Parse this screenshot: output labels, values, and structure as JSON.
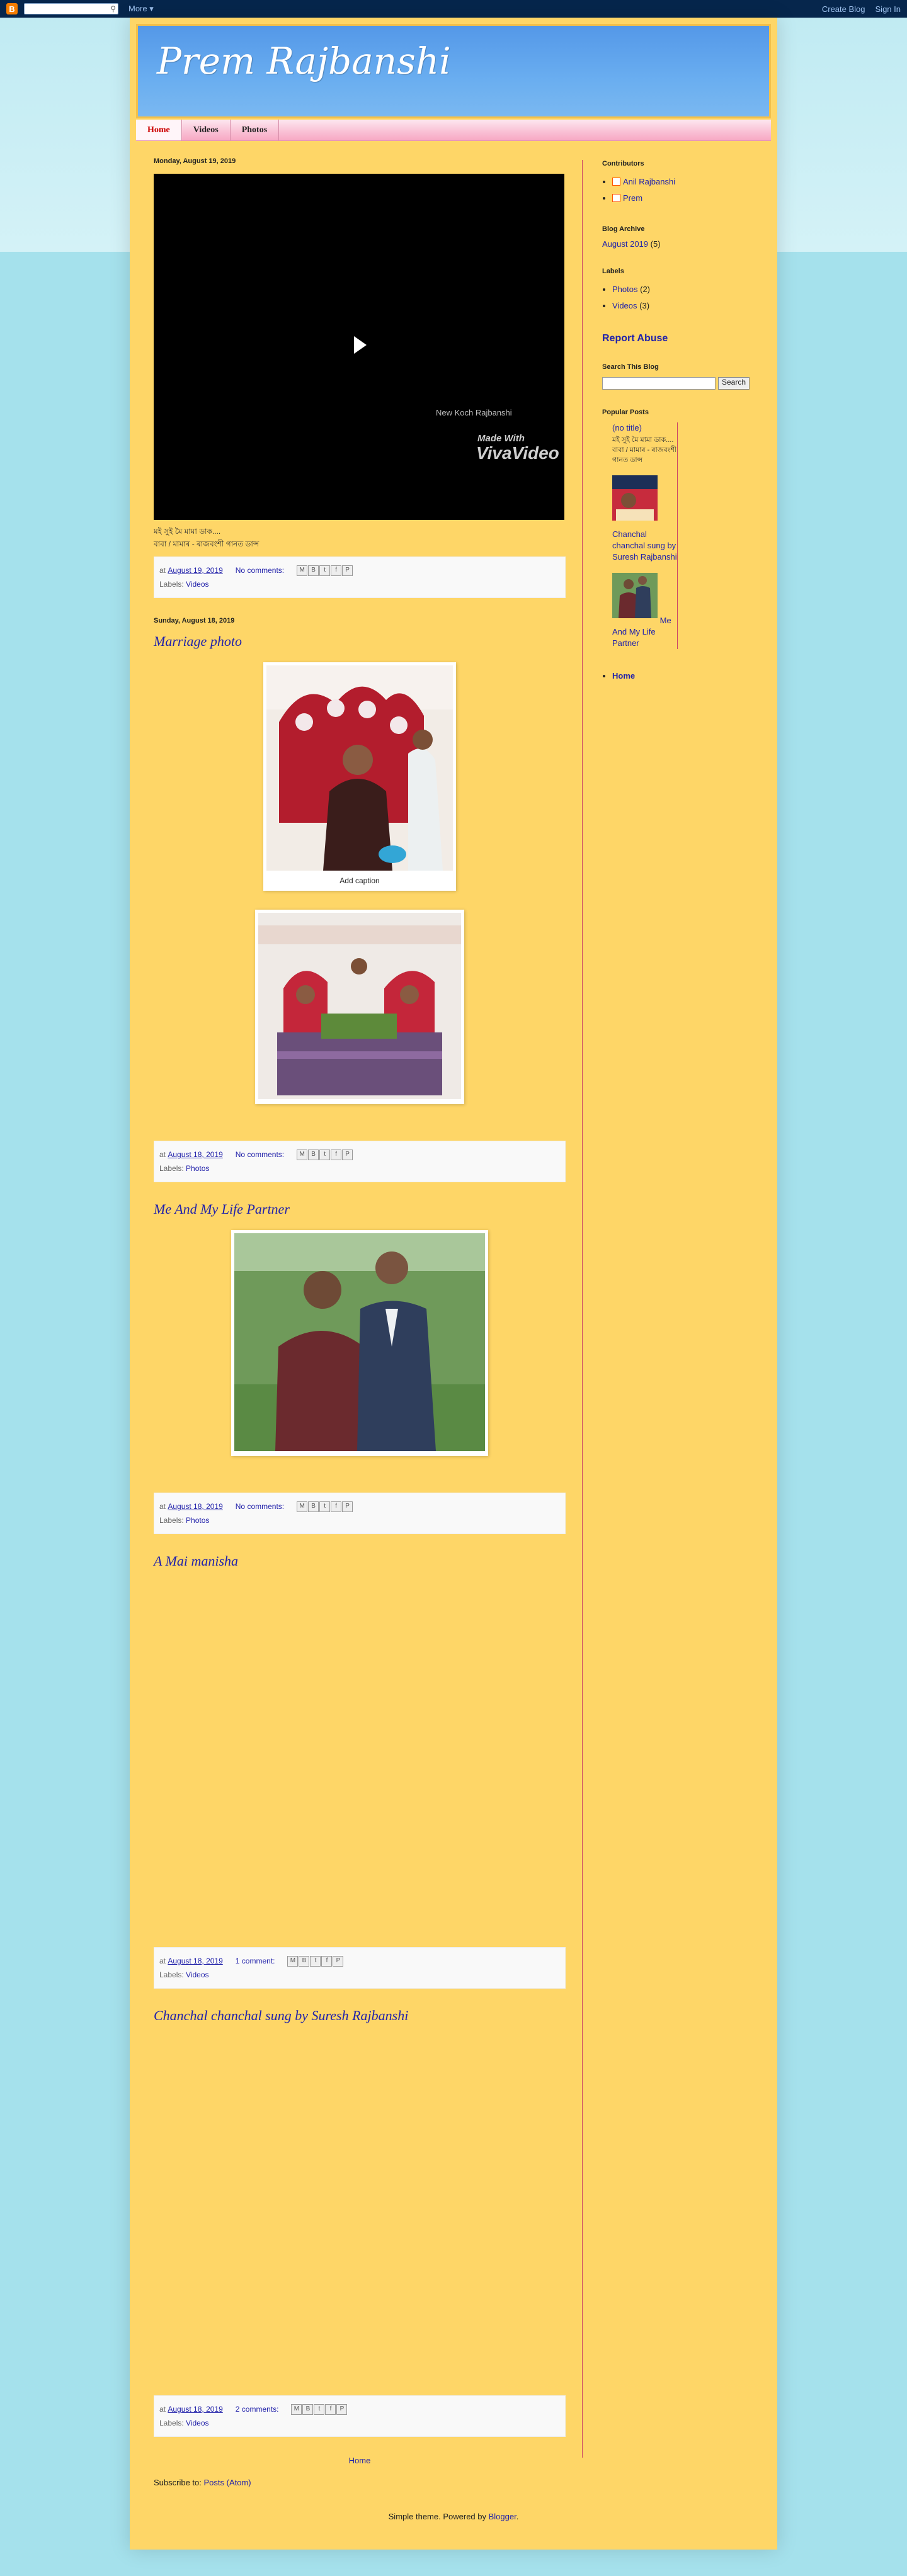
{
  "navbar": {
    "logo": "B",
    "more_label": "More ▾",
    "create_blog": "Create Blog",
    "sign_in": "Sign In"
  },
  "header": {
    "title": "Prem Rajbanshi"
  },
  "tabs": [
    {
      "label": "Home"
    },
    {
      "label": "Videos"
    },
    {
      "label": "Photos"
    }
  ],
  "posts": [
    {
      "date": "Monday, August 19, 2019",
      "video_watermark_1": "New Koch Rajbanshi",
      "video_watermark_2": "Made With",
      "video_watermark_3": "VivaVideo",
      "text_line_1": "মই সুই মৈ মামা ডাক....",
      "text_line_2": "বাবা / মামাৰ - ৰাজবংশী গানত ডান্স",
      "at": "at",
      "time": "August 19, 2019",
      "comments": "No comments:",
      "labels_prefix": "Labels:",
      "label": "Videos"
    },
    {
      "date": "Sunday, August 18, 2019",
      "title": "Marriage photo",
      "caption": "Add caption",
      "at": "at",
      "time": "August 18, 2019",
      "comments": "No comments:",
      "labels_prefix": "Labels:",
      "label": "Photos"
    },
    {
      "title": "Me And My Life Partner",
      "at": "at",
      "time": "August 18, 2019",
      "comments": "No comments:",
      "labels_prefix": "Labels:",
      "label": "Photos"
    },
    {
      "title": "A Mai manisha",
      "at": "at",
      "time": "August 18, 2019",
      "comments": "1 comment:",
      "labels_prefix": "Labels:",
      "label": "Videos"
    },
    {
      "title": "Chanchal chanchal sung by Suresh Rajbanshi",
      "at": "at",
      "time": "August 18, 2019",
      "comments": "2 comments:",
      "labels_prefix": "Labels:",
      "label": "Videos"
    }
  ],
  "share_icons": [
    "email-icon",
    "blogthis-icon",
    "twitter-icon",
    "facebook-icon",
    "pinterest-icon"
  ],
  "share_glyphs": [
    "M",
    "B",
    "t",
    "f",
    "P"
  ],
  "footer": {
    "home": "Home",
    "subscribe_prefix": "Subscribe to:",
    "subscribe_link": "Posts (Atom)",
    "attribution_prefix": "Simple theme. Powered by",
    "attribution_link": "Blogger",
    "attribution_suffix": "."
  },
  "sidebar": {
    "contributors_title": "Contributors",
    "contributors": [
      "Anil Rajbanshi",
      "Prem"
    ],
    "archive_title": "Blog Archive",
    "archive_item": "August 2019",
    "archive_count": "(5)",
    "labels_title": "Labels",
    "labels": [
      {
        "name": "Photos",
        "count": "(2)"
      },
      {
        "name": "Videos",
        "count": "(3)"
      }
    ],
    "report_abuse": "Report Abuse",
    "search_title": "Search This Blog",
    "search_button": "Search",
    "popular_title": "Popular Posts",
    "popular": [
      {
        "title": "(no title)",
        "snippet": "মই সুই মৈ মামা ডাক.... বাবা / মামাৰ - ৰাজবংশী গানত ডান্স"
      },
      {
        "title": "Chanchal chanchal sung by Suresh Rajbanshi"
      },
      {
        "title": "Me And My Life Partner"
      }
    ],
    "pages_home": "Home"
  },
  "colors": {
    "accent": "#2222aa",
    "background": "#fed667",
    "header": "#5d9fe9"
  }
}
